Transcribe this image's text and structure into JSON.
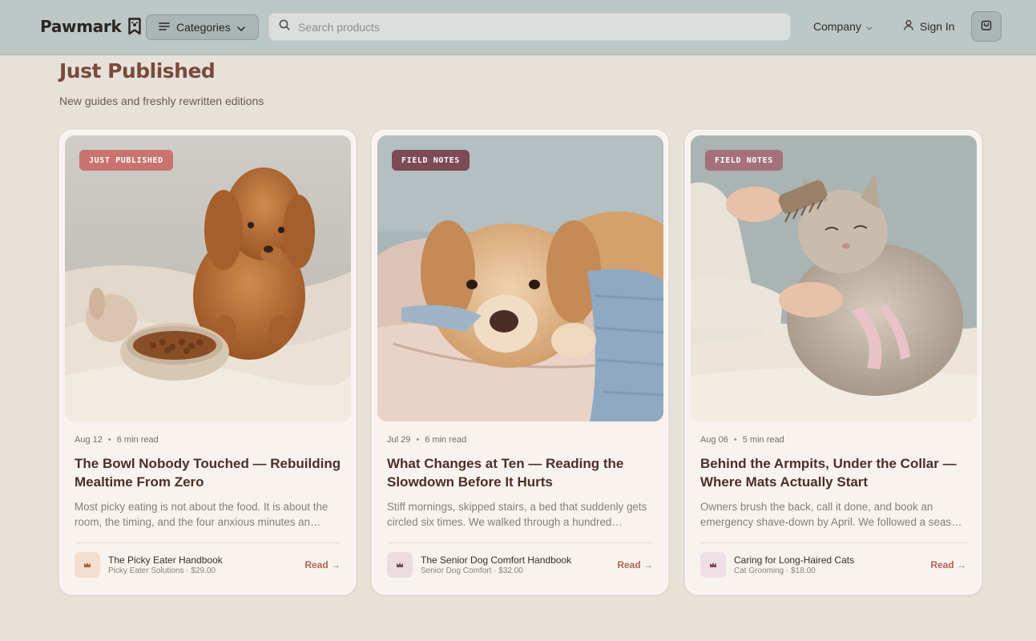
{
  "header": {
    "brand": "Pawmark",
    "categories_label": "Categories",
    "search_placeholder": "Search products",
    "company_label": "Company",
    "signin_label": "Sign In",
    "colors": {
      "bar": "#bcc7c6",
      "button": "#aab6b5"
    }
  },
  "section": {
    "title": "Just Published",
    "subtitle": "New guides and freshly rewritten editions"
  },
  "colors": {
    "accent": "#b5625a",
    "title": "#7a4a3c",
    "tag_just_published": "#c9736f",
    "tag_field_notes": "#7d4a55"
  },
  "cards": [
    {
      "tag": "JUST PUBLISHED",
      "image": "puppy-with-food-bowl-photo",
      "date": "Aug 12",
      "read_time": "6 min read",
      "title": "The Bowl Nobody Touched — Rebuilding Mealtime From Zero",
      "excerpt": "Most picky eating is not about the food. It is about the room, the timing, and the four anxious minutes an…",
      "product_name": "The Picky Eater Handbook",
      "product_sub": "Picky Eater Solutions · $29.00",
      "read_label": "Read →"
    },
    {
      "tag": "FIELD NOTES",
      "image": "senior-golden-retriever-photo",
      "date": "Jul 29",
      "read_time": "6 min read",
      "title": "What Changes at Ten — Reading the Slowdown Before It Hurts",
      "excerpt": "Stiff mornings, skipped stairs, a bed that suddenly gets circled six times. We walked through a hundred senior…",
      "product_name": "The Senior Dog Comfort Handbook",
      "product_sub": "Senior Dog Comfort · $32.00",
      "read_label": "Read →"
    },
    {
      "tag": "FIELD NOTES",
      "image": "long-haired-cat-brushing-photo",
      "date": "Aug 06",
      "read_time": "5 min read",
      "title": "Behind the Armpits, Under the Collar — Where Mats Actually Start",
      "excerpt": "Owners brush the back, call it done, and book an emergency shave-down by April. We followed a seas…",
      "product_name": "Caring for Long-Haired Cats",
      "product_sub": "Cat Grooming · $18.00",
      "read_label": "Read →"
    }
  ]
}
